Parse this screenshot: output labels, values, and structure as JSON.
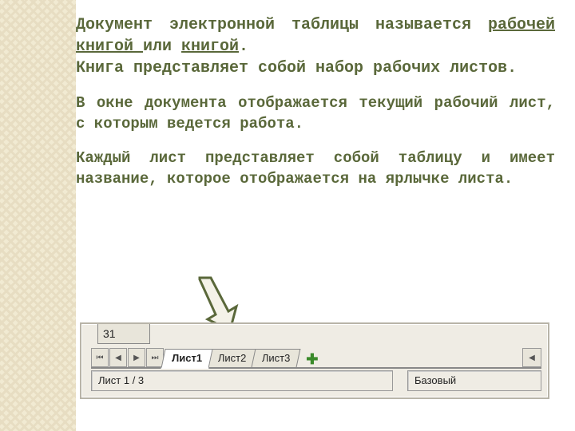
{
  "para1": {
    "pre": "Документ электронной таблицы  называется ",
    "u1": "рабочей книгой ",
    "mid": "или ",
    "u2": "книгой",
    "post1": ".",
    "line2": "Книга представляет собой набор рабочих листов."
  },
  "para2": "В окне документа отображается текущий рабочий лист, с которым ведется работа.",
  "para3": "Каждый лист представляет собой таблицу и имеет название, которое отображается на ярлычке листа.",
  "excel": {
    "row": "31",
    "nav": {
      "first": "⏮",
      "prev": "◀",
      "next": "▶",
      "last": "⏭"
    },
    "tabs": [
      "Лист1",
      "Лист2",
      "Лист3"
    ],
    "add": "✚",
    "scroll_left": "◀",
    "status_left": "Лист 1 / 3",
    "status_right": "Базовый"
  }
}
